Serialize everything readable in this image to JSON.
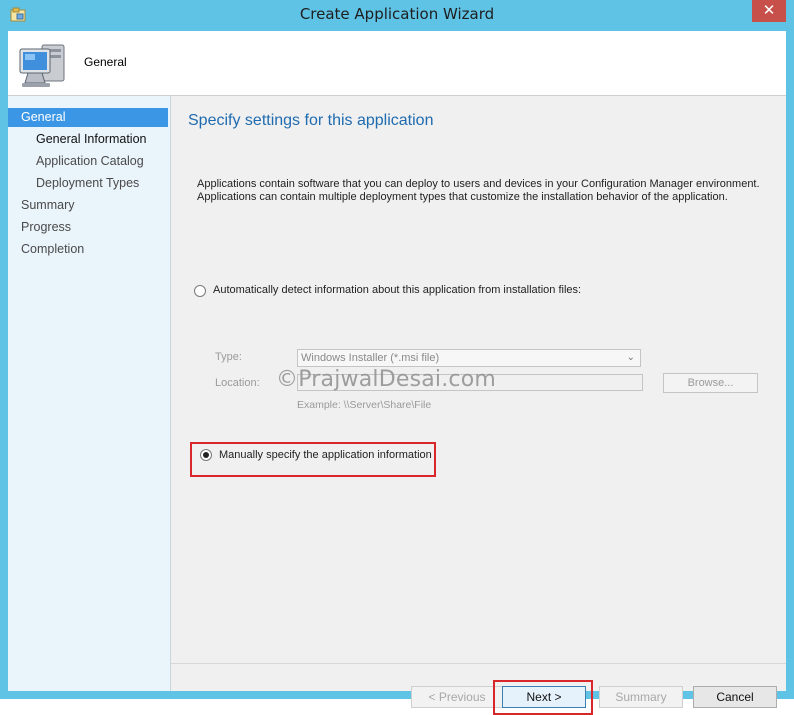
{
  "window": {
    "title": "Create Application Wizard",
    "close_label": "✕"
  },
  "header": {
    "title": "General"
  },
  "nav": {
    "items": [
      {
        "label": "General"
      },
      {
        "label": "General Information"
      },
      {
        "label": "Application Catalog"
      },
      {
        "label": "Deployment Types"
      },
      {
        "label": "Summary"
      },
      {
        "label": "Progress"
      },
      {
        "label": "Completion"
      }
    ]
  },
  "main": {
    "heading": "Specify settings for this application",
    "description_line1": "Applications contain software that you can deploy to users and devices in your Configuration Manager environment.",
    "description_line2": "Applications can contain multiple deployment types that customize the installation behavior of the application.",
    "auto_detect_label": "Automatically detect information about this application from installation files:",
    "type_label": "Type:",
    "type_value": "Windows Installer (*.msi file)",
    "location_label": "Location:",
    "location_value": "",
    "browse_label": "Browse...",
    "example_text": "Example: \\\\Server\\Share\\File",
    "manual_label": "Manually specify the application information",
    "watermark": "©PrajwalDesai.com"
  },
  "footer": {
    "previous_label": "< Previous",
    "next_label": "Next >",
    "summary_label": "Summary",
    "cancel_label": "Cancel"
  },
  "colors": {
    "accent": "#3c96e6",
    "heading": "#1f6bb0",
    "highlight": "#d9262b",
    "frame": "#5fc3e6"
  }
}
